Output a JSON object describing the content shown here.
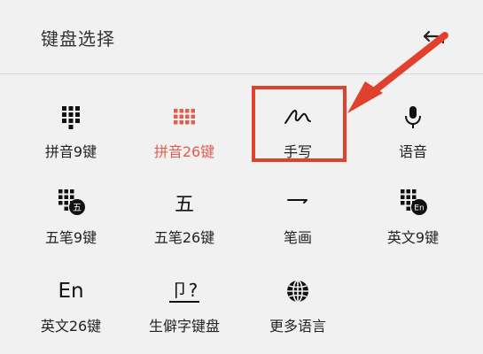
{
  "header": {
    "title": "键盘选择",
    "back_icon": "undo-arrow-icon"
  },
  "keyboards": [
    {
      "label": "拼音9键",
      "icon": "keypad-9-icon",
      "active": false
    },
    {
      "label": "拼音26键",
      "icon": "keypad-26-icon",
      "active": true
    },
    {
      "label": "手写",
      "icon": "handwriting-icon",
      "active": false
    },
    {
      "label": "语音",
      "icon": "microphone-icon",
      "active": false
    },
    {
      "label": "五笔9键",
      "icon": "keypad-9-wubi-icon",
      "badge": "五",
      "active": false
    },
    {
      "label": "五笔26键",
      "icon_text": "五",
      "icon": "wubi-character-icon",
      "active": false
    },
    {
      "label": "笔画",
      "icon": "stroke-icon",
      "active": false
    },
    {
      "label": "英文9键",
      "icon": "keypad-9-english-icon",
      "badge": "En",
      "active": false
    },
    {
      "label": "英文26键",
      "icon_text": "En",
      "icon": "english-text-icon",
      "active": false
    },
    {
      "label": "生僻字键盘",
      "icon_text": "卩?",
      "icon": "rare-character-icon",
      "active": false
    },
    {
      "label": "更多语言",
      "icon": "globe-icon",
      "active": false
    }
  ],
  "colors": {
    "accent": "#e35c50",
    "highlight": "#e0412d",
    "background": "#f1f1f1"
  }
}
